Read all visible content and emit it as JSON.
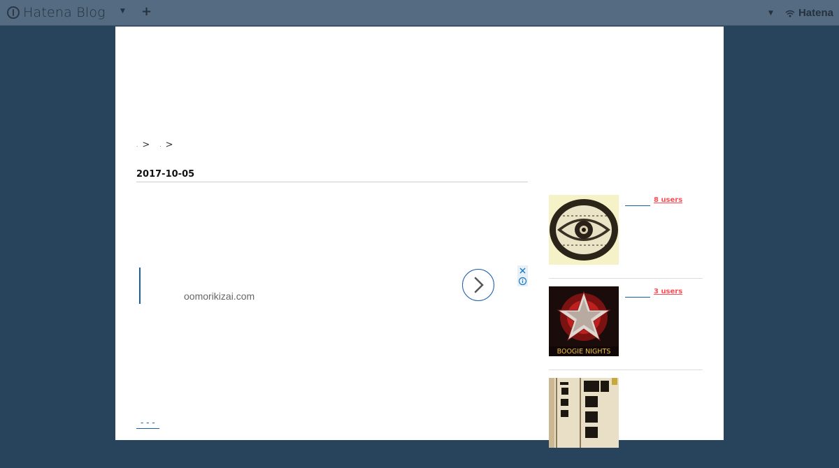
{
  "header": {
    "brand": "Hatena Blog",
    "right_brand": "Hatena"
  },
  "breadcrumb": {
    "separator_1": ">",
    "separator_2": ">"
  },
  "article": {
    "date": "2017-10-05"
  },
  "ad": {
    "domain": "oomorikizai.com"
  },
  "bottom_link": {
    "text": "- - -"
  },
  "sidebar": {
    "entries": [
      {
        "users": "8 users",
        "image_caption": ""
      },
      {
        "users": "3 users",
        "image_caption": "BOOGIE NIGHTS"
      },
      {
        "users": "",
        "image_caption": ""
      }
    ]
  },
  "colors": {
    "background": "#27445c",
    "topbar": "#556b81",
    "accent": "#1a5da8",
    "users_badge": "#ff4d55"
  }
}
